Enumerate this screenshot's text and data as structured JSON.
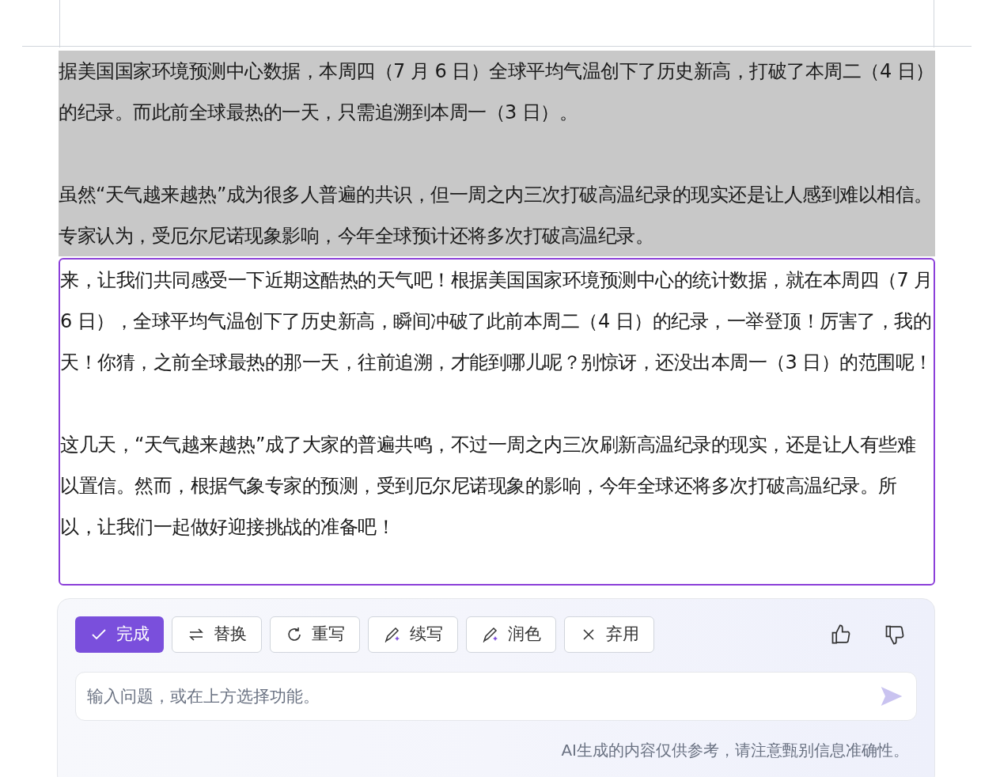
{
  "source_paragraphs": [
    {
      "text": "据美国国家环境预测中心数据，本周四（7 月 6 日）全球平均气温创下了历史新高，打破了本周二（4 日）的纪录。而此前全球最热的一天，只需追溯到本周一（3 日）。",
      "selected": true
    },
    {
      "text": "虽然“天气越来越热”成为很多人普遍的共识，但一周之内三次打破高温纪录的现实还是让人感到难以相信。专家认为，受厄尔尼诺现象影响，今年全球预计还将多次打破高温纪录。",
      "selected": true
    }
  ],
  "rewrite_paragraphs": [
    "来，让我们共同感受一下近期这酷热的天气吧！根据美国国家环境预测中心的统计数据，就在本周四（7 月 6 日），全球平均气温创下了历史新高，瞬间冲破了此前本周二（4 日）的纪录，一举登顶！厉害了，我的天！你猜，之前全球最热的那一天，往前追溯，才能到哪儿呢？别惊讶，还没出本周一（3 日）的范围呢！",
    "这几天，“天气越来越热”成了大家的普遍共鸣，不过一周之内三次刷新高温纪录的现实，还是让人有些难以置信。然而，根据气象专家的预测，受到厄尔尼诺现象的影响，今年全球还将多次打破高温纪录。所以，让我们一起做好迎接挑战的准备吧！"
  ],
  "actions": [
    {
      "kind": "done",
      "label": "完成",
      "primary": true
    },
    {
      "kind": "replace",
      "label": "替换",
      "primary": false
    },
    {
      "kind": "rewrite",
      "label": "重写",
      "primary": false
    },
    {
      "kind": "continue",
      "label": "续写",
      "primary": false
    },
    {
      "kind": "polish",
      "label": "润色",
      "primary": false
    },
    {
      "kind": "discard",
      "label": "弃用",
      "primary": false
    }
  ],
  "prompt": {
    "placeholder": "输入问题，或在上方选择功能。"
  },
  "disclaimer": "AI生成的内容仅供参考，请注意甄别信息准确性。"
}
